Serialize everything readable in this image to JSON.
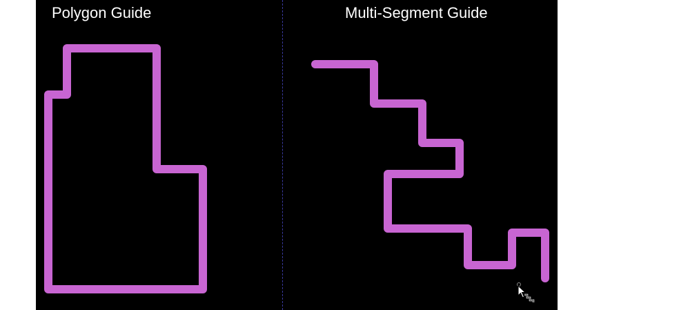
{
  "panels": {
    "left_title": "Polygon Guide",
    "right_title": "Multi-Segment Guide"
  },
  "colors": {
    "background": "#000000",
    "guide_stroke": "#c865d2",
    "text": "#ffffff",
    "divider": "#3a3aa0"
  },
  "cursor": {
    "icon": "multi-segment-draw-cursor-icon"
  }
}
